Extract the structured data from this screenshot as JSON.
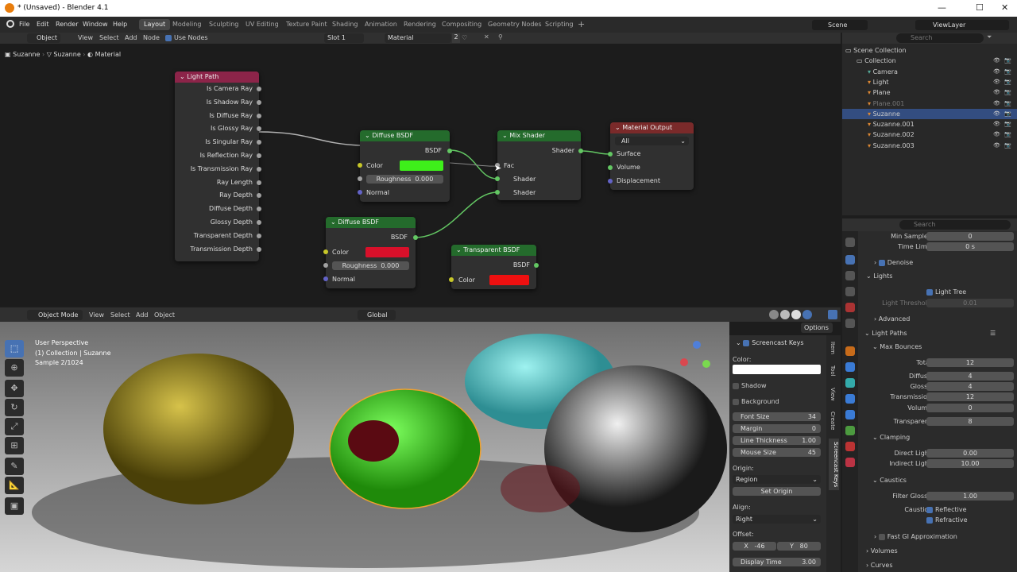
{
  "window": {
    "title": "* (Unsaved) - Blender 4.1",
    "minimize": "—",
    "maximize": "☐",
    "close": "✕"
  },
  "menu": [
    "File",
    "Edit",
    "Render",
    "Window",
    "Help"
  ],
  "workspaces": [
    "Layout",
    "Modeling",
    "Sculpting",
    "UV Editing",
    "Texture Paint",
    "Shading",
    "Animation",
    "Rendering",
    "Compositing",
    "Geometry Nodes",
    "Scripting"
  ],
  "active_workspace": "Layout",
  "scene": "Scene",
  "view_layer": "ViewLayer",
  "node_header": {
    "mode": "Object",
    "menus": [
      "View",
      "Select",
      "Add",
      "Node"
    ],
    "use_nodes": "Use Nodes",
    "slot": "Slot 1",
    "material": "Material",
    "users": "2"
  },
  "breadcrumb": [
    "Suzanne",
    "Suzanne",
    "Material"
  ],
  "light_path": {
    "title": "Light Path",
    "outputs": [
      "Is Camera Ray",
      "Is Shadow Ray",
      "Is Diffuse Ray",
      "Is Glossy Ray",
      "Is Singular Ray",
      "Is Reflection Ray",
      "Is Transmission Ray",
      "Ray Length",
      "Ray Depth",
      "Diffuse Depth",
      "Glossy Depth",
      "Transparent Depth",
      "Transmission Depth"
    ]
  },
  "diffuse1": {
    "title": "Diffuse BSDF",
    "out": "BSDF",
    "color_label": "Color",
    "color": "#3ef01a",
    "rough_label": "Roughness",
    "rough": "0.000",
    "normal": "Normal"
  },
  "diffuse2": {
    "title": "Diffuse BSDF",
    "out": "BSDF",
    "color_label": "Color",
    "color": "#d8102a",
    "rough_label": "Roughness",
    "rough": "0.000",
    "normal": "Normal"
  },
  "mix": {
    "title": "Mix Shader",
    "out": "Shader",
    "fac": "Fac",
    "in1": "Shader",
    "in2": "Shader"
  },
  "transparent": {
    "title": "Transparent BSDF",
    "out": "BSDF",
    "color_label": "Color",
    "color": "#ee1010"
  },
  "matout": {
    "title": "Material Output",
    "target": "All",
    "surface": "Surface",
    "volume": "Volume",
    "displacement": "Displacement"
  },
  "viewport": {
    "mode": "Object Mode",
    "menus": [
      "View",
      "Select",
      "Add",
      "Object"
    ],
    "orientation": "Global",
    "options": "Options",
    "info1": "User Perspective",
    "info2": "(1) Collection | Suzanne",
    "info3": "Sample 2/1024"
  },
  "screencast": {
    "title": "Screencast Keys",
    "color_label": "Color:",
    "shadow": "Shadow",
    "background": "Background",
    "font_size_label": "Font Size",
    "font_size": "34",
    "margin_label": "Margin",
    "margin": "0",
    "line_label": "Line Thickness",
    "line": "1.00",
    "mouse_label": "Mouse Size",
    "mouse": "45",
    "origin_label": "Origin:",
    "origin": "Region",
    "set_origin": "Set Origin",
    "align_label": "Align:",
    "align": "Right",
    "offset_label": "Offset:",
    "x_label": "X",
    "x": "-46",
    "y_label": "Y",
    "y": "80",
    "display_label": "Display Time",
    "display": "3.00"
  },
  "ntabs": [
    "Item",
    "Tool",
    "View",
    "Create",
    "Screencast Keys"
  ],
  "outliner": {
    "search": "Search",
    "items": [
      {
        "name": "Scene Collection",
        "indent": 0
      },
      {
        "name": "Collection",
        "indent": 1
      },
      {
        "name": "Camera",
        "indent": 2
      },
      {
        "name": "Light",
        "indent": 2
      },
      {
        "name": "Plane",
        "indent": 2
      },
      {
        "name": "Plane.001",
        "indent": 2
      },
      {
        "name": "Suzanne",
        "indent": 2
      },
      {
        "name": "Suzanne.001",
        "indent": 2
      },
      {
        "name": "Suzanne.002",
        "indent": 2
      },
      {
        "name": "Suzanne.003",
        "indent": 2
      }
    ]
  },
  "props": {
    "search": "Search",
    "min_samples_label": "Min Samples",
    "min_samples": "0",
    "time_limit_label": "Time Limit",
    "time_limit": "0 s",
    "denoise": "Denoise",
    "lights": "Lights",
    "light_tree": "Light Tree",
    "light_threshold_label": "Light Threshold",
    "light_threshold": "0.01",
    "advanced": "Advanced",
    "light_paths": "Light Paths",
    "max_bounces": "Max Bounces",
    "total_label": "Total",
    "total": "12",
    "diffuse_label": "Diffuse",
    "diffuse": "4",
    "glossy_label": "Glossy",
    "glossy": "4",
    "transmission_label": "Transmission",
    "transmission": "12",
    "volume_label": "Volume",
    "volume": "0",
    "transparent_label": "Transparent",
    "transparent": "8",
    "clamping": "Clamping",
    "direct_label": "Direct Light",
    "direct": "0.00",
    "indirect_label": "Indirect Light",
    "indirect": "10.00",
    "caustics": "Caustics",
    "filter_glossy_label": "Filter Glossy",
    "filter_glossy": "1.00",
    "caustics_label": "Caustics",
    "reflective": "Reflective",
    "refractive": "Refractive",
    "fast_gi": "Fast GI Approximation",
    "volumes": "Volumes",
    "curves": "Curves"
  }
}
